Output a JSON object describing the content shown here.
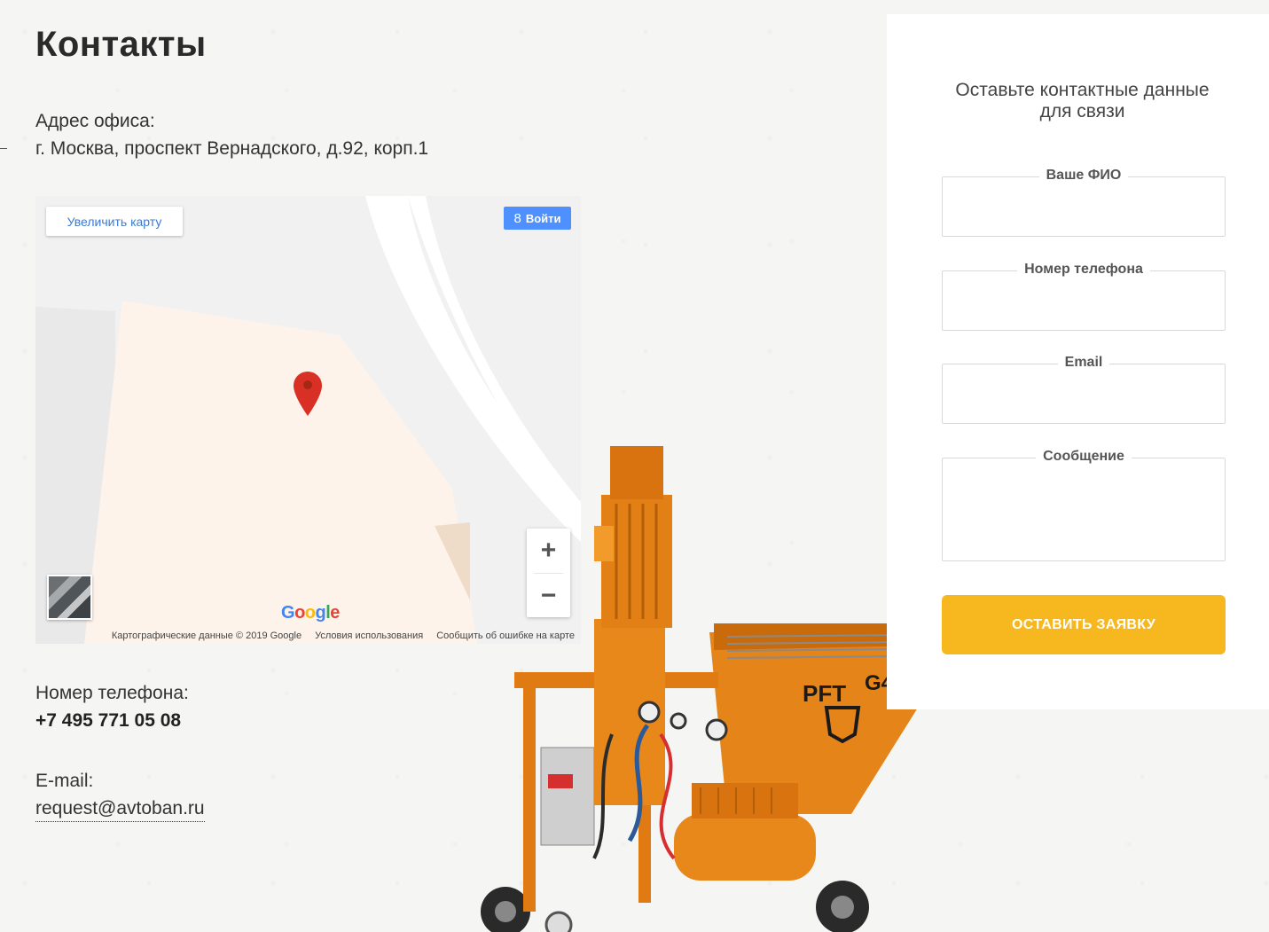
{
  "page": {
    "title": "Контакты"
  },
  "address": {
    "label": "Адрес офиса:",
    "value": "г. Москва, проспект Вернадского, д.92, корп.1"
  },
  "map": {
    "enlarge_label": "Увеличить карту",
    "signin_label": "Войти",
    "signin_icon": "google-plus-icon",
    "zoom_in": "+",
    "zoom_out": "−",
    "logo": "Google",
    "footer": {
      "data": "Картографические данные © 2019 Google",
      "terms": "Условия использования",
      "report": "Сообщить об ошибке на карте"
    }
  },
  "phone": {
    "label": "Номер телефона:",
    "value": "+7 495 771 05 08"
  },
  "email": {
    "label": "E-mail:",
    "value": "request@avtoban.ru"
  },
  "form": {
    "title_line1": "Оставьте контактные данные",
    "title_line2": "для связи",
    "fields": [
      {
        "label": "Ваше ФИО"
      },
      {
        "label": "Номер телефона"
      },
      {
        "label": "Email"
      },
      {
        "label": "Сообщение"
      }
    ],
    "submit_label": "ОСТАВИТЬ ЗАЯВКУ"
  },
  "product_image": {
    "text": "PFT",
    "model": "G4"
  },
  "colors": {
    "accent": "#f7b81f",
    "map_pin": "#d93025",
    "link": "#3a7bd5"
  }
}
